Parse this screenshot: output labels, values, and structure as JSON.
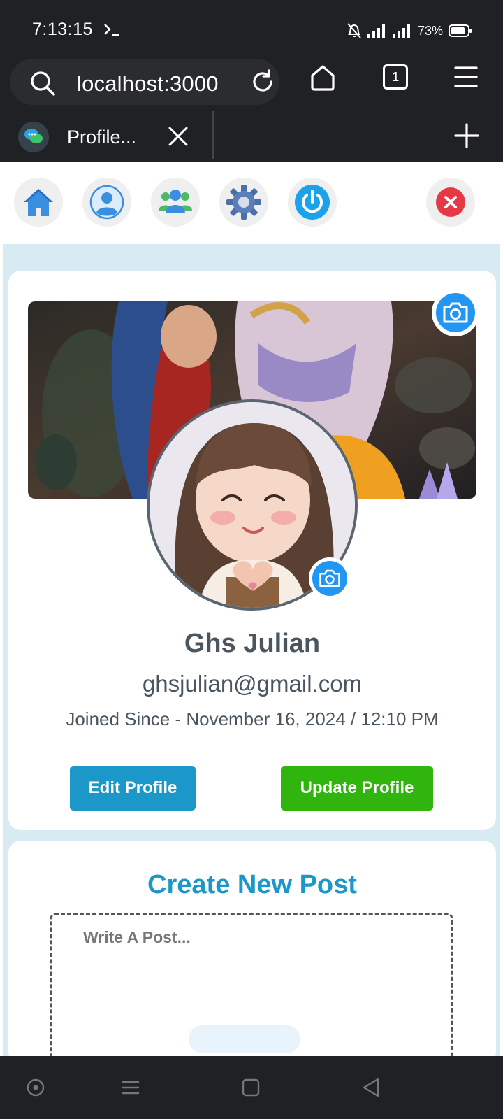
{
  "status_bar": {
    "time": "7:13:15",
    "battery": "73%"
  },
  "browser": {
    "url": "localhost:3000",
    "tab_count": "1",
    "tab_title": "Profile..."
  },
  "profile": {
    "name": "Ghs Julian",
    "email": "ghsjulian@gmail.com",
    "joined": "Joined Since - November 16, 2024 / 12:10 PM",
    "edit_label": "Edit Profile",
    "update_label": "Update Profile"
  },
  "post": {
    "title": "Create New Post",
    "placeholder": "Write A Post..."
  },
  "colors": {
    "accent_blue": "#1c97c9",
    "accent_green": "#2fb50d",
    "camera_blue": "#2196f3",
    "close_red": "#e53945",
    "page_bg": "#d9ebf2"
  }
}
